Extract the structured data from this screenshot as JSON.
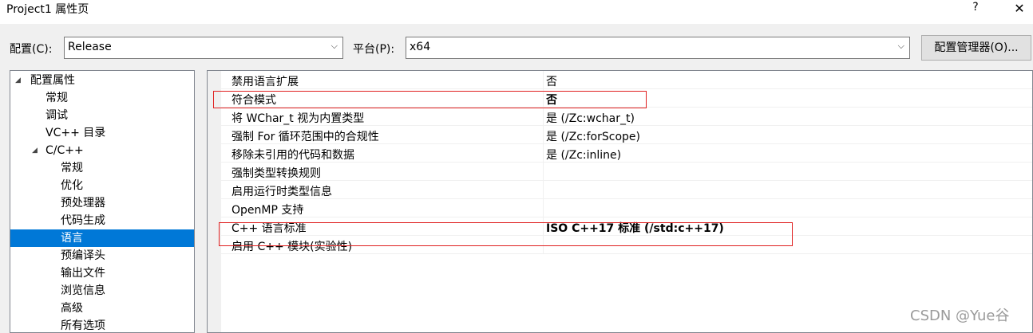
{
  "window": {
    "title": "Project1 属性页",
    "help": "?",
    "close": "✕"
  },
  "config": {
    "label": "配置(C):",
    "value": "Release"
  },
  "platform": {
    "label": "平台(P):",
    "value": "x64"
  },
  "manager_button": "配置管理器(O)...",
  "tree": [
    {
      "label": "配置属性",
      "expanded": true
    },
    {
      "label": "常规"
    },
    {
      "label": "调试"
    },
    {
      "label": "VC++ 目录"
    },
    {
      "label": "C/C++",
      "expanded": true
    },
    {
      "label": "常规"
    },
    {
      "label": "优化"
    },
    {
      "label": "预处理器"
    },
    {
      "label": "代码生成"
    },
    {
      "label": "语言",
      "selected": true
    },
    {
      "label": "预编译头"
    },
    {
      "label": "输出文件"
    },
    {
      "label": "浏览信息"
    },
    {
      "label": "高级"
    },
    {
      "label": "所有选项"
    }
  ],
  "properties": [
    {
      "name": "禁用语言扩展",
      "value": "否"
    },
    {
      "name": "符合模式",
      "value": "否",
      "bold": true
    },
    {
      "name": "将 WChar_t 视为内置类型",
      "value": "是 (/Zc:wchar_t)"
    },
    {
      "name": "强制 For 循环范围中的合规性",
      "value": "是 (/Zc:forScope)"
    },
    {
      "name": "移除未引用的代码和数据",
      "value": "是 (/Zc:inline)"
    },
    {
      "name": "强制类型转换规则",
      "value": ""
    },
    {
      "name": "启用运行时类型信息",
      "value": ""
    },
    {
      "name": "OpenMP 支持",
      "value": ""
    },
    {
      "name": "C++ 语言标准",
      "value": "ISO C++17 标准 (/std:c++17)",
      "bold": true
    },
    {
      "name": "启用 C++ 模块(实验性)",
      "value": ""
    }
  ],
  "watermark": "CSDN @Yue谷",
  "colors": {
    "selection": "#0078d7",
    "highlight_box": "#e02020"
  }
}
